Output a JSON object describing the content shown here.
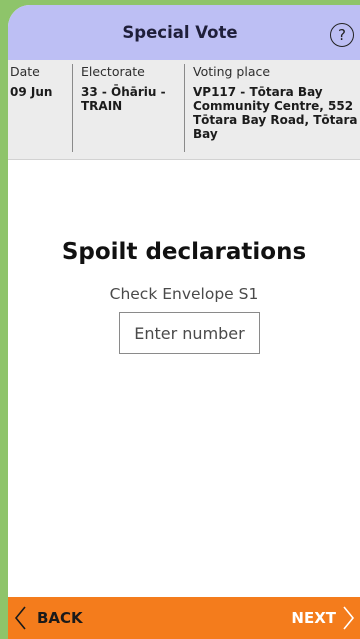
{
  "header": {
    "title": "Special Vote",
    "help_icon": "question-circle-icon",
    "help_glyph": "?"
  },
  "info": {
    "date_label": "Date",
    "date_value": "09 Jun",
    "electorate_label": "Electorate",
    "electorate_value": "33 - Ōhāriu - TRAIN",
    "place_label": "Voting place",
    "place_value": "VP117 - Tōtara Bay Community Centre, 552 Tōtara Bay Road, Tōtara Bay"
  },
  "main": {
    "title": "Spoilt declarations",
    "subtitle": "Check Envelope S1",
    "input_placeholder": "Enter number",
    "input_value": ""
  },
  "footer": {
    "back_label": "BACK",
    "next_label": "NEXT",
    "back_icon": "chevron-left-icon",
    "next_icon": "chevron-right-icon"
  },
  "colors": {
    "page_background": "#8ec46a",
    "header_background": "#bdbff4",
    "info_background": "#ececec",
    "footer_background": "#f47c1c"
  }
}
